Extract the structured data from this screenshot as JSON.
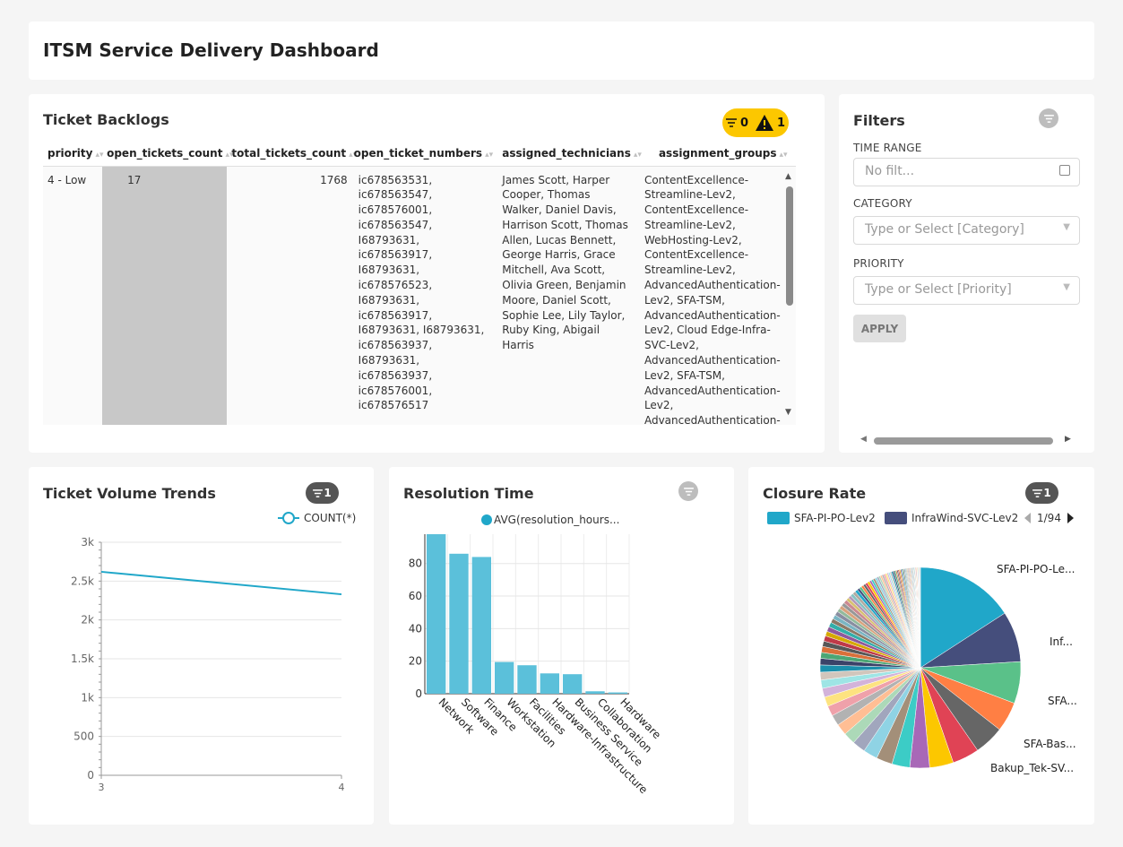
{
  "header": {
    "title": "ITSM Service Delivery Dashboard"
  },
  "backlog": {
    "title": "Ticket Backlogs",
    "badge_filters": "0",
    "badge_warnings": "1",
    "columns": [
      "priority",
      "open_tickets_count",
      "total_tickets_count",
      "open_ticket_numbers",
      "assigned_technicians",
      "assignment_groups"
    ],
    "rows": [
      {
        "priority": "4 - Low",
        "open_tickets_count": "17",
        "total_tickets_count": "1768",
        "open_ticket_numbers": "ic678563531, ic678563547, ic678576001, ic678563547, I68793631, ic678563917, I68793631, ic678576523, I68793631, ic678563917, I68793631, I68793631, ic678563937, I68793631, ic678563937, ic678576001, ic678576517",
        "assigned_technicians": "James Scott, Harper Cooper, Thomas Walker, Daniel Davis, Harrison Scott, Thomas Allen, Lucas Bennett, George Harris, Grace Mitchell, Ava Scott, Olivia Green, Benjamin Moore, Daniel Scott, Sophie Lee, Lily Taylor, Ruby King, Abigail Harris",
        "assignment_groups": "ContentExcellence-Streamline-Lev2, ContentExcellence-Streamline-Lev2, WebHosting-Lev2, ContentExcellence-Streamline-Lev2, AdvancedAuthentication-Lev2, SFA-TSM, AdvancedAuthentication-Lev2, Cloud Edge-Infra-SVC-Lev2, AdvancedAuthentication-Lev2, SFA-TSM, AdvancedAuthentication-Lev2, AdvancedAuthentication-"
      }
    ]
  },
  "filters": {
    "title": "Filters",
    "time_range_label": "TIME RANGE",
    "time_range_placeholder": "No filt...",
    "category_label": "CATEGORY",
    "category_placeholder": "Type or Select [Category]",
    "priority_label": "PRIORITY",
    "priority_placeholder": "Type or Select [Priority]",
    "apply_label": "APPLY"
  },
  "trends": {
    "title": "Ticket Volume Trends",
    "filter_count": "1",
    "chart_data": {
      "type": "line",
      "x": [
        3,
        4
      ],
      "series": [
        {
          "name": "COUNT(*)",
          "values": [
            2620,
            2330
          ],
          "color": "#20a7c9"
        }
      ],
      "ylim": [
        0,
        3000
      ],
      "yticks": [
        "0",
        "500",
        "1k",
        "1.5k",
        "2k",
        "2.5k",
        "3k"
      ],
      "xticks": [
        "3",
        "4"
      ],
      "grid": true,
      "legend": "top-right"
    }
  },
  "restime": {
    "title": "Resolution Time",
    "chart_data": {
      "type": "bar",
      "categories": [
        "Network",
        "Software",
        "Finance",
        "Workstation",
        "Facilities",
        "Hardware-Infrastructure",
        "Business Service",
        "Collaboration",
        "Hardware"
      ],
      "series": [
        {
          "name": "AVG(resolution_hours...",
          "values": [
            98,
            86,
            84,
            19.5,
            17.5,
            12.5,
            12,
            1.5,
            0.8
          ],
          "color": "#5bc0da"
        }
      ],
      "ylim": [
        0,
        98
      ],
      "yticks": [
        "0",
        "20",
        "40",
        "60",
        "80"
      ],
      "grid": true,
      "legend": "top"
    }
  },
  "closure": {
    "title": "Closure Rate",
    "filter_count": "1",
    "legend_page": "1/94",
    "chart_data": {
      "type": "pie",
      "legend_items": [
        {
          "name": "SFA-PI-PO-Lev2",
          "color": "#20a7c9"
        },
        {
          "name": "InfraWind-SVC-Lev2",
          "color": "#454e7c"
        }
      ],
      "slice_labels": [
        "SFA-PI-PO-Le...",
        "Inf...",
        "SFA...",
        "SFA-Bas...",
        "Bakup_Tek-SV..."
      ],
      "slices": [
        {
          "value": 16.5,
          "color": "#20a7c9"
        },
        {
          "value": 8.5,
          "color": "#454e7c"
        },
        {
          "value": 7.0,
          "color": "#5ac189"
        },
        {
          "value": 5.0,
          "color": "#ff7f44"
        },
        {
          "value": 5.0,
          "color": "#666666"
        },
        {
          "value": 4.5,
          "color": "#e04355"
        },
        {
          "value": 4.0,
          "color": "#fcc700"
        },
        {
          "value": 3.3,
          "color": "#a868b7"
        },
        {
          "value": 3.0,
          "color": "#3cccc6"
        },
        {
          "value": 2.7,
          "color": "#a38f79"
        },
        {
          "value": 2.4,
          "color": "#8fd3e4"
        },
        {
          "value": 2.2,
          "color": "#a1a6bd"
        },
        {
          "value": 2.0,
          "color": "#acd9b8"
        },
        {
          "value": 1.9,
          "color": "#ffbe94"
        },
        {
          "value": 1.8,
          "color": "#b2b2b2"
        },
        {
          "value": 1.7,
          "color": "#efa1aa"
        },
        {
          "value": 1.6,
          "color": "#fde380"
        },
        {
          "value": 1.5,
          "color": "#d3b3da"
        },
        {
          "value": 1.4,
          "color": "#9ee5e5"
        },
        {
          "value": 1.3,
          "color": "#d1c6bc"
        },
        {
          "value": 1.2,
          "color": "#1b8fac"
        },
        {
          "value": 1.1,
          "color": "#3b4369"
        },
        {
          "value": 1.0,
          "color": "#4ca675"
        },
        {
          "value": 1.0,
          "color": "#d9703a"
        },
        {
          "value": 0.9,
          "color": "#575757"
        },
        {
          "value": 0.9,
          "color": "#bf3a48"
        },
        {
          "value": 0.8,
          "color": "#d6a900"
        },
        {
          "value": 0.8,
          "color": "#8f599c"
        },
        {
          "value": 0.8,
          "color": "#33aea9"
        },
        {
          "value": 0.7,
          "color": "#8b7a67"
        },
        {
          "value": 0.7,
          "color": "#7ab5c3"
        },
        {
          "value": 0.7,
          "color": "#898ea1"
        },
        {
          "value": 0.6,
          "color": "#93ba9d"
        },
        {
          "value": 0.6,
          "color": "#d9a27e"
        },
        {
          "value": 0.6,
          "color": "#989898"
        },
        {
          "value": 0.6,
          "color": "#cc8991"
        },
        {
          "value": 0.5,
          "color": "#d7c16d"
        },
        {
          "value": 0.5,
          "color": "#b499b9"
        },
        {
          "value": 0.5,
          "color": "#86c3c3"
        },
        {
          "value": 0.5,
          "color": "#b2a9a0"
        },
        {
          "value": 0.5,
          "color": "#20a7c9"
        },
        {
          "value": 0.4,
          "color": "#454e7c"
        },
        {
          "value": 0.4,
          "color": "#5ac189"
        },
        {
          "value": 0.4,
          "color": "#ff7f44"
        },
        {
          "value": 0.4,
          "color": "#666666"
        },
        {
          "value": 0.4,
          "color": "#e04355"
        },
        {
          "value": 0.4,
          "color": "#fcc700"
        },
        {
          "value": 0.35,
          "color": "#a868b7"
        },
        {
          "value": 0.35,
          "color": "#3cccc6"
        },
        {
          "value": 0.35,
          "color": "#a38f79"
        },
        {
          "value": 0.35,
          "color": "#8fd3e4"
        },
        {
          "value": 0.3,
          "color": "#a1a6bd"
        },
        {
          "value": 0.3,
          "color": "#acd9b8"
        },
        {
          "value": 0.3,
          "color": "#ffbe94"
        },
        {
          "value": 0.3,
          "color": "#b2b2b2"
        },
        {
          "value": 0.3,
          "color": "#efa1aa"
        },
        {
          "value": 0.3,
          "color": "#fde380"
        },
        {
          "value": 0.25,
          "color": "#d3b3da"
        },
        {
          "value": 0.25,
          "color": "#9ee5e5"
        },
        {
          "value": 0.25,
          "color": "#d1c6bc"
        },
        {
          "value": 0.25,
          "color": "#1b8fac"
        },
        {
          "value": 0.25,
          "color": "#3b4369"
        },
        {
          "value": 0.25,
          "color": "#4ca675"
        },
        {
          "value": 0.2,
          "color": "#d9703a"
        },
        {
          "value": 0.2,
          "color": "#575757"
        },
        {
          "value": 0.2,
          "color": "#bf3a48"
        },
        {
          "value": 0.2,
          "color": "#d6a900"
        },
        {
          "value": 0.2,
          "color": "#8f599c"
        },
        {
          "value": 0.2,
          "color": "#33aea9"
        },
        {
          "value": 0.2,
          "color": "#8b7a67"
        },
        {
          "value": 0.2,
          "color": "#7ab5c3"
        },
        {
          "value": 0.15,
          "color": "#898ea1"
        },
        {
          "value": 0.15,
          "color": "#93ba9d"
        },
        {
          "value": 0.15,
          "color": "#d9a27e"
        },
        {
          "value": 0.15,
          "color": "#989898"
        },
        {
          "value": 0.15,
          "color": "#cc8991"
        },
        {
          "value": 0.15,
          "color": "#d7c16d"
        },
        {
          "value": 0.15,
          "color": "#b499b9"
        },
        {
          "value": 0.15,
          "color": "#86c3c3"
        },
        {
          "value": 0.15,
          "color": "#b2a9a0"
        },
        {
          "value": 0.1,
          "color": "#20a7c9"
        },
        {
          "value": 0.1,
          "color": "#454e7c"
        },
        {
          "value": 0.1,
          "color": "#5ac189"
        },
        {
          "value": 0.1,
          "color": "#ff7f44"
        },
        {
          "value": 0.1,
          "color": "#666666"
        },
        {
          "value": 0.1,
          "color": "#e04355"
        },
        {
          "value": 0.1,
          "color": "#fcc700"
        },
        {
          "value": 0.1,
          "color": "#a868b7"
        },
        {
          "value": 0.1,
          "color": "#3cccc6"
        },
        {
          "value": 0.1,
          "color": "#a38f79"
        },
        {
          "value": 0.1,
          "color": "#8fd3e4"
        },
        {
          "value": 0.1,
          "color": "#a1a6bd"
        }
      ]
    }
  }
}
